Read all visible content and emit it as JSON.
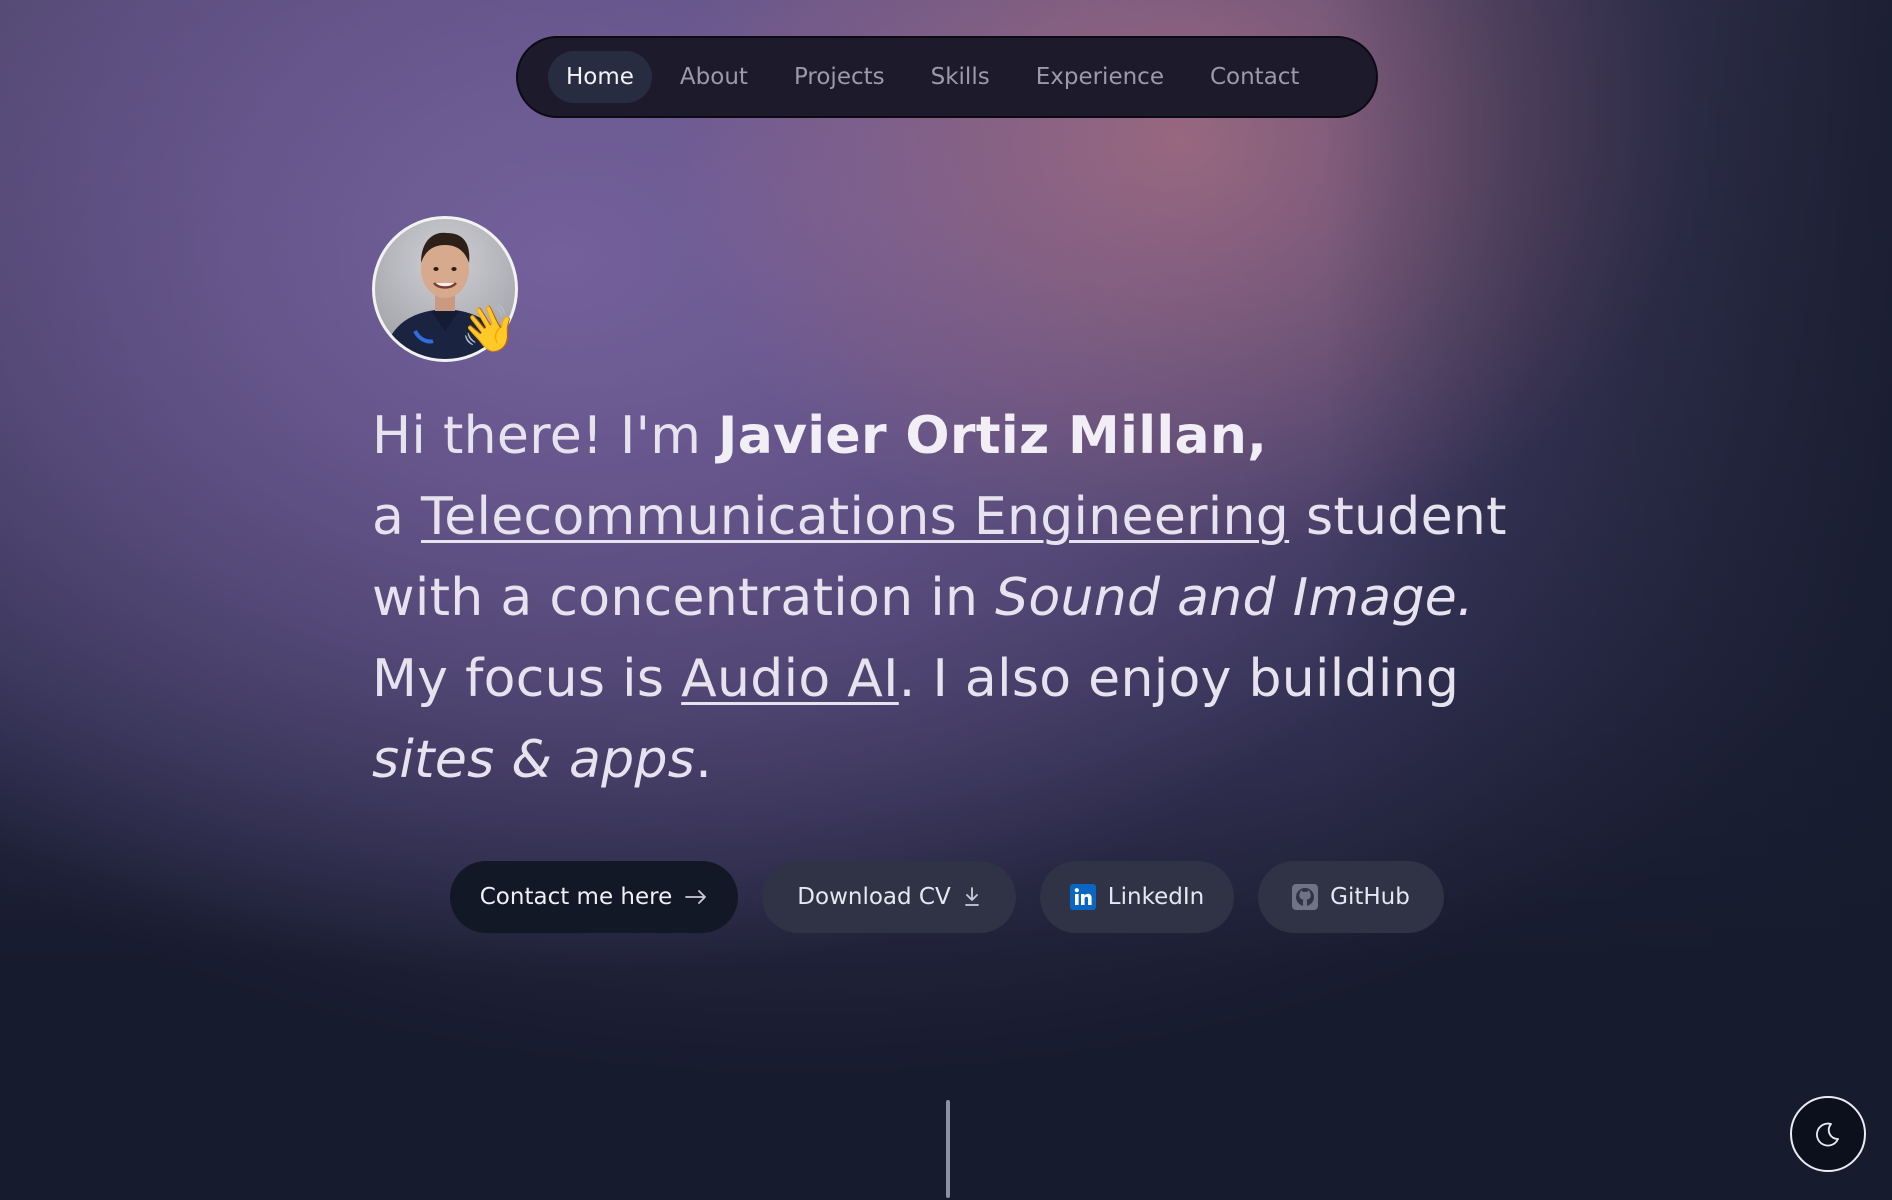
{
  "nav": {
    "items": [
      {
        "label": "Home",
        "active": true
      },
      {
        "label": "About"
      },
      {
        "label": "Projects"
      },
      {
        "label": "Skills"
      },
      {
        "label": "Experience"
      },
      {
        "label": "Contact"
      }
    ]
  },
  "hero": {
    "avatar_alt": "Javier Ortiz Millan",
    "wave_emoji": "👋",
    "line1_prefix": "Hi there! I'm ",
    "name": "Javier Ortiz Millan,",
    "line2_prefix": "a ",
    "degree_link": "Telecommunications Engineering",
    "line2_suffix": " student",
    "line3_prefix": "with a concentration in ",
    "concentration": "Sound and Image.",
    "line4_prefix": "My focus is ",
    "focus_link": "Audio AI",
    "line4_suffix": ". I also enjoy building",
    "hobby": "sites & apps",
    "hobby_suffix": "."
  },
  "actions": {
    "contact_label": "Contact me here",
    "contact_icon": "arrow-right-icon",
    "cv_label": "Download CV",
    "cv_icon": "download-icon",
    "linkedin_label": "LinkedIn",
    "linkedin_icon": "linkedin-icon",
    "github_label": "GitHub",
    "github_icon": "github-icon"
  },
  "theme_toggle": {
    "icon": "moon-icon"
  },
  "colors": {
    "accent_linkedin": "#0a66c2",
    "primary_button": "#121826",
    "secondary_button": "#2f3345"
  }
}
